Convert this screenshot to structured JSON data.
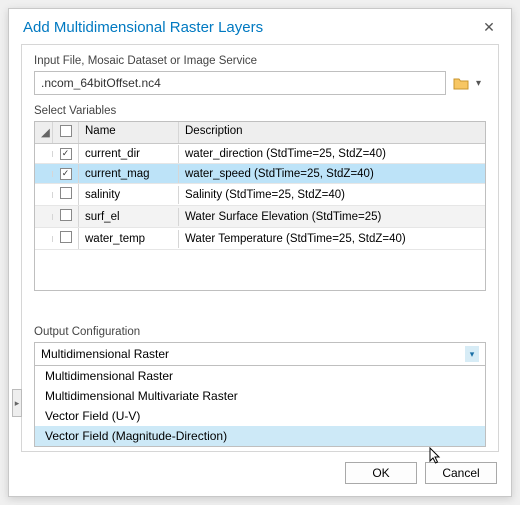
{
  "title": "Add Multidimensional Raster Layers",
  "input_label": "Input File, Mosaic Dataset or Image Service",
  "input_value": ".ncom_64bitOffset.nc4",
  "select_vars_label": "Select Variables",
  "table": {
    "headers": {
      "name": "Name",
      "desc": "Description"
    },
    "rows": [
      {
        "checked": true,
        "selected": false,
        "alt": false,
        "name": "current_dir",
        "desc": "water_direction (StdTime=25, StdZ=40)"
      },
      {
        "checked": true,
        "selected": true,
        "alt": true,
        "name": "current_mag",
        "desc": "water_speed (StdTime=25, StdZ=40)"
      },
      {
        "checked": false,
        "selected": false,
        "alt": false,
        "name": "salinity",
        "desc": "Salinity (StdTime=25, StdZ=40)"
      },
      {
        "checked": false,
        "selected": false,
        "alt": true,
        "name": "surf_el",
        "desc": "Water Surface Elevation (StdTime=25)"
      },
      {
        "checked": false,
        "selected": false,
        "alt": false,
        "name": "water_temp",
        "desc": "Water Temperature (StdTime=25, StdZ=40)"
      }
    ]
  },
  "output_label": "Output Configuration",
  "output_selected": "Multidimensional Raster",
  "output_options": [
    {
      "label": "Multidimensional Raster",
      "hover": false
    },
    {
      "label": "Multidimensional Multivariate Raster",
      "hover": false
    },
    {
      "label": "Vector Field (U-V)",
      "hover": false
    },
    {
      "label": "Vector Field (Magnitude-Direction)",
      "hover": true
    }
  ],
  "buttons": {
    "ok": "OK",
    "cancel": "Cancel"
  }
}
